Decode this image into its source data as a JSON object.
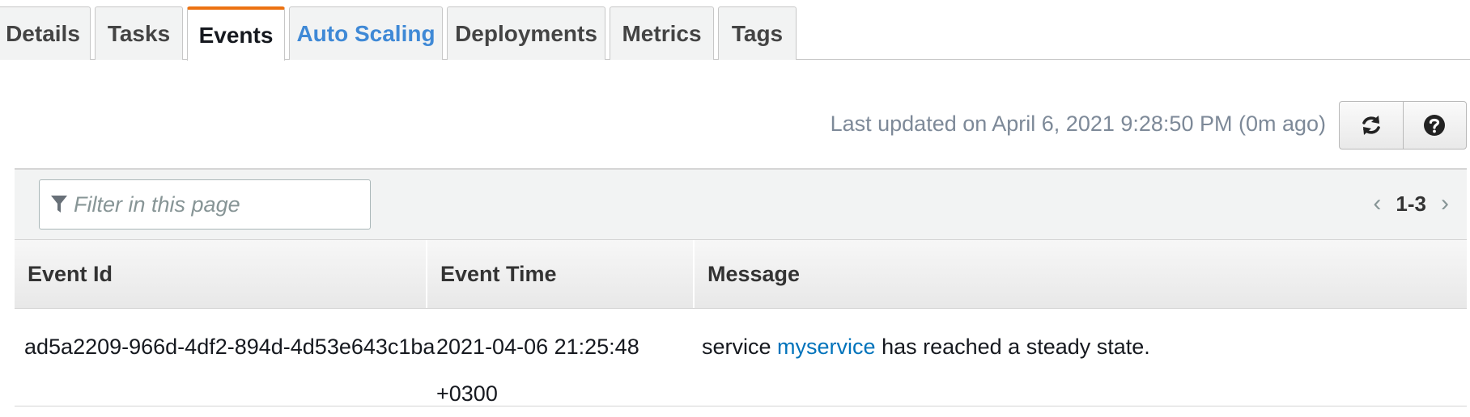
{
  "tabs": [
    {
      "label": "Details"
    },
    {
      "label": "Tasks"
    },
    {
      "label": "Events"
    },
    {
      "label": "Auto Scaling"
    },
    {
      "label": "Deployments"
    },
    {
      "label": "Metrics"
    },
    {
      "label": "Tags"
    }
  ],
  "active_tab": "Events",
  "toolbar": {
    "last_updated": "Last updated on April 6, 2021 9:28:50 PM (0m ago)",
    "refresh_icon": "refresh-icon",
    "help_icon": "help-icon"
  },
  "filter": {
    "placeholder": "Filter in this page",
    "icon": "funnel-icon"
  },
  "pagination": {
    "range": "1-3",
    "prev_icon": "chevron-left-icon",
    "next_icon": "chevron-right-icon"
  },
  "table": {
    "columns": [
      "Event Id",
      "Event Time",
      "Message"
    ],
    "rows": [
      {
        "event_id": "ad5a2209-966d-4df2-894d-4d53e643c1ba",
        "event_time_date": "2021-04-06 21:25:48",
        "event_time_tz": "+0300",
        "message_prefix": "service",
        "message_link": "myservice",
        "message_suffix": "has reached a steady state."
      }
    ]
  },
  "colors": {
    "active_tab_accent": "#ec7211",
    "link": "#0073bb",
    "tab_link": "#3f89d6"
  }
}
